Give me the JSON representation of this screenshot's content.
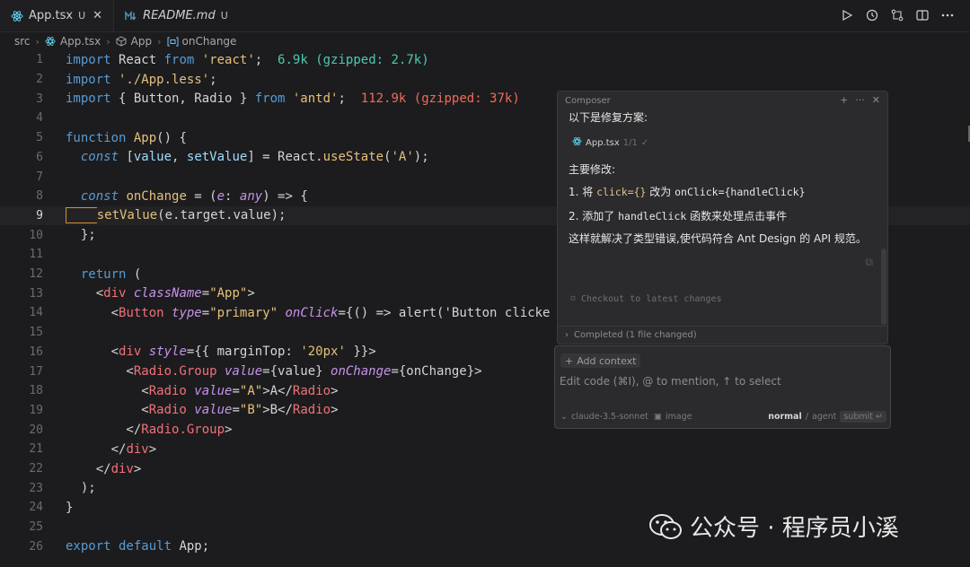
{
  "tabs": [
    {
      "label": "App.tsx",
      "badge": "U",
      "close": "✕",
      "icon": "react-icon"
    },
    {
      "label": "README.md",
      "badge": "U",
      "icon": "markdown-icon"
    }
  ],
  "breadcrumb": [
    "src",
    "App.tsx",
    "App",
    "onChange"
  ],
  "line_numbers": [
    "1",
    "2",
    "3",
    "4",
    "5",
    "6",
    "7",
    "8",
    "9",
    "10",
    "11",
    "12",
    "13",
    "14",
    "15",
    "16",
    "17",
    "18",
    "19",
    "20",
    "21",
    "22",
    "23",
    "24",
    "25",
    "26"
  ],
  "code": {
    "l1": {
      "kw": "import",
      "name": " React ",
      "from": "from",
      "str": " 'react'",
      "end": ";",
      "size": "6.9k (gzipped: 2.7k)"
    },
    "l2": {
      "kw": "import",
      "str": " './App.less'",
      "end": ";"
    },
    "l3": {
      "kw": "import",
      "name": " { Button, Radio } ",
      "from": "from",
      "str": " 'antd'",
      "end": ";",
      "size": "112.9k (gzipped: 37k)"
    },
    "l5": {
      "kw": "function",
      "name": " App",
      "rest": "() {"
    },
    "l6": {
      "kw": "  const",
      "rest1": " [",
      "v1": "value",
      "c": ", ",
      "v2": "setValue",
      "rest2": "] = React.",
      "fn": "useState",
      "rest3": "(",
      "str": "'A'",
      "rest4": ");"
    },
    "l8": {
      "kw": "  const",
      "fn": " onChange",
      "rest1": " = (",
      "param": "e",
      "rest2": ": ",
      "type": "any",
      "rest3": ") => {"
    },
    "l9": {
      "indent": "    ",
      "fn": "setValue",
      "rest": "(e.target.value);"
    },
    "l10": {
      "text": "  };"
    },
    "l12": {
      "kw": "  return",
      "rest": " ("
    },
    "l13": {
      "open": "    <",
      "tag": "div",
      "attr": " className",
      "eq": "=",
      "str": "\"App\"",
      "close": ">"
    },
    "l14": {
      "open": "      <",
      "tag": "Button",
      "attr": " type",
      "eq": "=",
      "str": "\"primary\"",
      "attr2": " onClick",
      "rest": "={() => alert('Button clicke"
    },
    "l16": {
      "open": "      <",
      "tag": "div",
      "attr": " style",
      "rest": "={{ marginTop: ",
      "str": "'20px'",
      "rest2": " }}>"
    },
    "l17": {
      "open": "        <",
      "tag": "Radio.Group",
      "attr": " value",
      "rest": "={value} ",
      "attr2": "onChange",
      "rest2": "={onChange}>"
    },
    "l18": {
      "open": "          <",
      "tag": "Radio",
      "attr": " value",
      "eq": "=",
      "str": "\"A\"",
      "mid": ">A</",
      "tag2": "Radio",
      "close": ">"
    },
    "l19": {
      "open": "          <",
      "tag": "Radio",
      "attr": " value",
      "eq": "=",
      "str": "\"B\"",
      "mid": ">B</",
      "tag2": "Radio",
      "close": ">"
    },
    "l20": {
      "open": "        </",
      "tag": "Radio.Group",
      "close": ">"
    },
    "l21": {
      "open": "      </",
      "tag": "div",
      "close": ">"
    },
    "l22": {
      "open": "    </",
      "tag": "div",
      "close": ">"
    },
    "l23": {
      "text": "  );"
    },
    "l24": {
      "text": "}"
    },
    "l26": {
      "kw": "export default",
      "rest": " App;"
    }
  },
  "composer": {
    "title": "Composer",
    "intro": "以下是修复方案:",
    "file_chip": "App.tsx",
    "file_count": "1/1",
    "heading": "主要修改:",
    "item1_pre": "1. 将 ",
    "item1_code1": "click={}",
    "item1_mid": " 改为 ",
    "item1_code2": "onClick={handleClick}",
    "item2_pre": "2. 添加了 ",
    "item2_code": "handleClick",
    "item2_post": " 函数来处理点击事件",
    "summary": "这样就解决了类型错误,使代码符合 Ant Design 的 API 规范。",
    "checkout": "Checkout to latest changes",
    "footer": "Completed (1 file changed)"
  },
  "input": {
    "add_context": "Add context",
    "placeholder": "Edit code (⌘I), @ to mention, ↑ to select",
    "model": "claude-3.5-sonnet",
    "image": "image",
    "mode_normal": "normal",
    "mode_agent": "agent",
    "submit": "submit"
  },
  "watermark": "公众号 · 程序员小溪"
}
